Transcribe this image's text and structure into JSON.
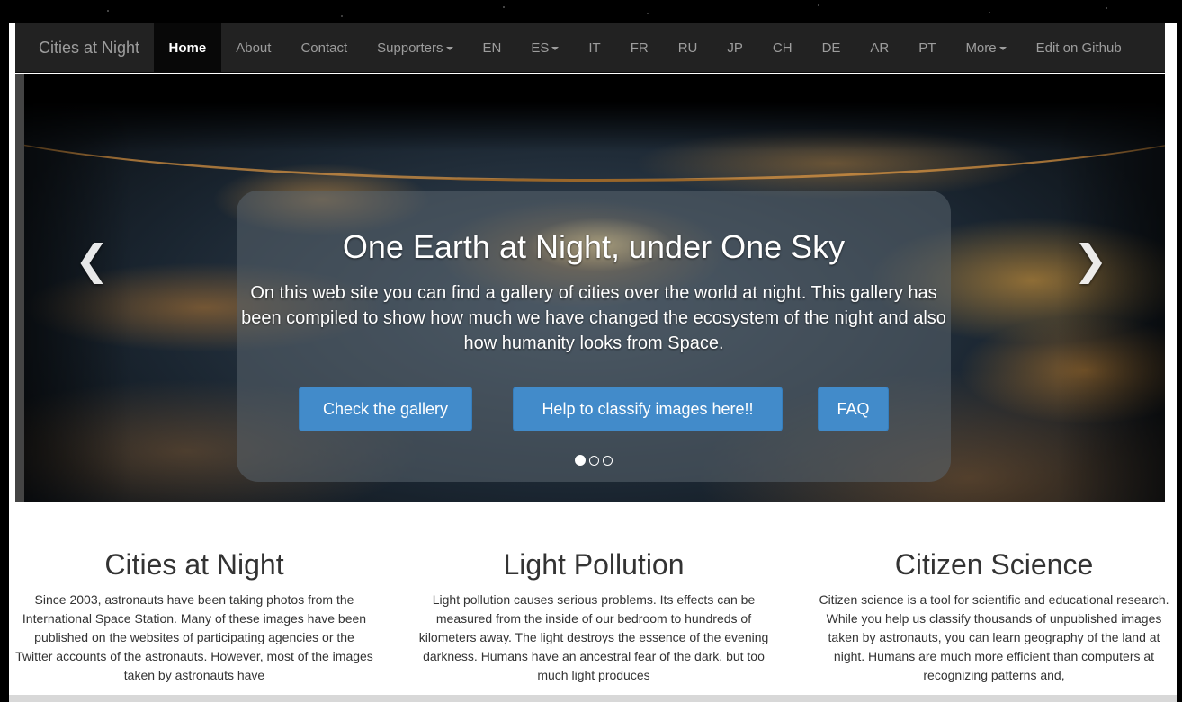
{
  "navbar": {
    "brand": "Cities at Night",
    "items": [
      {
        "label": "Home",
        "active": true
      },
      {
        "label": "About"
      },
      {
        "label": "Contact"
      },
      {
        "label": "Supporters",
        "dropdown": true
      },
      {
        "label": "EN"
      },
      {
        "label": "ES",
        "dropdown": true
      },
      {
        "label": "IT"
      },
      {
        "label": "FR"
      },
      {
        "label": "RU"
      },
      {
        "label": "JP"
      },
      {
        "label": "CH"
      },
      {
        "label": "DE"
      },
      {
        "label": "AR"
      },
      {
        "label": "PT"
      },
      {
        "label": "More",
        "dropdown": true
      },
      {
        "label": "Edit on Github"
      }
    ]
  },
  "carousel": {
    "title": "One Earth at Night, under One Sky",
    "text": "On this web site you can find a gallery of cities over the world at night. This gallery has been compiled to show how much we have changed the ecosystem of the night and also how humanity looks from Space.",
    "buttons": [
      "Check the gallery",
      "Help to classify images here!!",
      "FAQ"
    ],
    "prev_icon": "chevron-left-icon",
    "next_icon": "chevron-right-icon",
    "prev_glyph": "❮",
    "next_glyph": "❯",
    "slide_count": 3,
    "active_slide": 1
  },
  "columns": [
    {
      "title": "Cities at Night",
      "text": "Since 2003, astronauts have been taking photos from the International Space Station. Many of these images have been published on the websites of participating agencies or the Twitter accounts of the astronauts. However, most of the images taken by astronauts have"
    },
    {
      "title": "Light Pollution",
      "text": "Light pollution causes serious problems. Its effects can be measured from the inside of our bedroom to hundreds of kilometers away. The light destroys the essence of the evening darkness. Humans have an ancestral fear of the dark, but too much light produces"
    },
    {
      "title": "Citizen Science",
      "text": "Citizen science is a tool for scientific and educational research. While you help us classify thousands of unpublished images taken by astronauts, you can learn geography of the land at night. Humans are much more efficient than computers at recognizing patterns and,"
    }
  ],
  "colors": {
    "navbar_bg": "#222222",
    "nav_text": "#9d9d9d",
    "button": "#428bca"
  }
}
